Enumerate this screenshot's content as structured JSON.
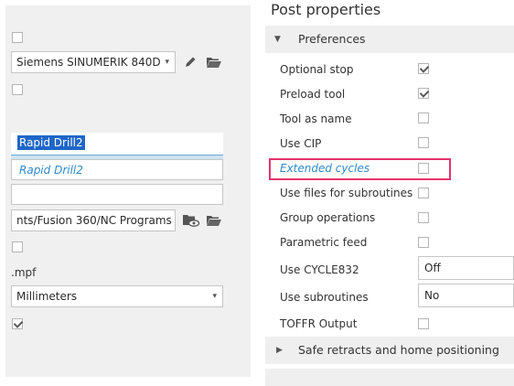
{
  "left_panel": {
    "machine_select": "Siemens SINUMERIK 840D",
    "program_name_value": "Rapid Drill2",
    "program_name_suggestion": "Rapid Drill2",
    "comment_value": "",
    "output_folder": "nts/Fusion 360/NC Programs",
    "extension_label": ".mpf",
    "units_select": "Millimeters"
  },
  "post_properties": {
    "title": "Post properties",
    "section_preferences": "Preferences",
    "section_safe_retracts": "Safe retracts and home positioning",
    "rows": [
      {
        "label": "Optional stop",
        "checked": true
      },
      {
        "label": "Preload tool",
        "checked": true
      },
      {
        "label": "Tool as name",
        "checked": false
      },
      {
        "label": "Use CIP",
        "checked": false
      },
      {
        "label": "Extended cycles",
        "checked": false
      },
      {
        "label": "Use files for subroutines",
        "checked": false
      },
      {
        "label": "Group operations",
        "checked": false
      },
      {
        "label": "Parametric feed",
        "checked": false
      },
      {
        "label": "Use CYCLE832",
        "value": "Off"
      },
      {
        "label": "Use subroutines",
        "value": "No"
      },
      {
        "label": "TOFFR Output",
        "checked": false
      }
    ]
  },
  "colors": {
    "highlight": "#e5336c",
    "selection_bg": "#1f66c9",
    "suggestion_text": "#2f89c9"
  },
  "icons": [
    "pencil-icon",
    "folder-open-icon",
    "folder-eye-icon",
    "triangle-down-icon",
    "triangle-right-icon"
  ]
}
